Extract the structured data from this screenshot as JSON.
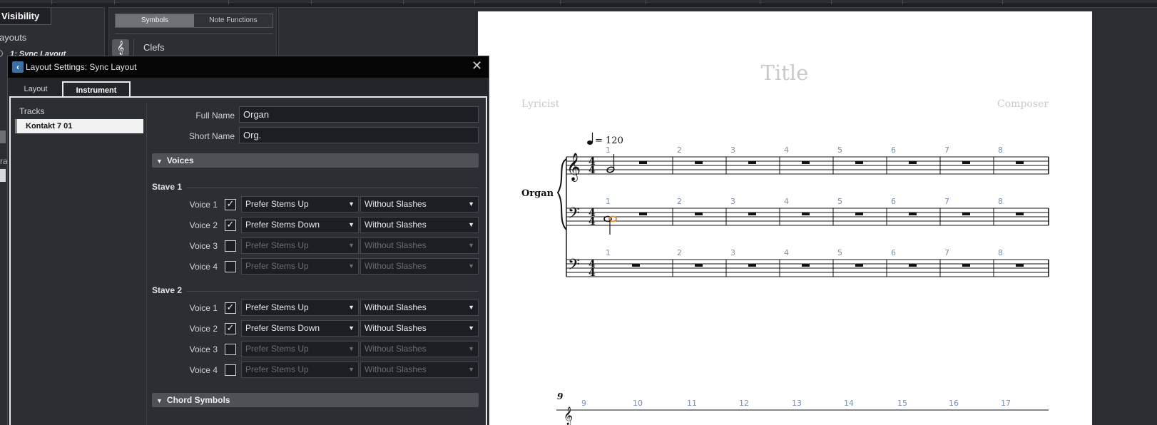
{
  "background": {
    "visibility_tab": "Visibility",
    "layouts_label": "ayouts",
    "sync_layout_item": "1: Sync Layout",
    "fragment_text": "ra",
    "symbols_tabs": [
      "Symbols",
      "Note Functions"
    ],
    "clefs_label": "Clefs"
  },
  "score": {
    "title": "Title",
    "lyricist": "Lyricist",
    "composer": "Composer",
    "tempo": "= 120",
    "instrument": "Organ",
    "bar_numbers": [
      "1",
      "2",
      "3",
      "4",
      "5",
      "6",
      "7",
      "8"
    ],
    "system2_bar_numbers": [
      "9",
      "10",
      "11",
      "12",
      "13",
      "14",
      "15",
      "16",
      "17"
    ],
    "system2_start": "9",
    "accent_color": "#e08a2a"
  },
  "dialog": {
    "title": "Layout Settings: Sync Layout",
    "tabs": {
      "layout": "Layout",
      "instrument": "Instrument"
    },
    "tracks_label": "Tracks",
    "selected_track": "Kontakt 7 01",
    "full_name_label": "Full Name",
    "full_name_value": "Organ",
    "short_name_label": "Short Name",
    "short_name_value": "Org.",
    "voices_section": "Voices",
    "chord_section": "Chord Symbols",
    "staves": [
      {
        "title": "Stave 1",
        "voices": [
          {
            "label": "Voice 1",
            "checked": true,
            "stem": "Prefer Stems Up",
            "slash": "Without Slashes"
          },
          {
            "label": "Voice 2",
            "checked": true,
            "stem": "Prefer Stems Down",
            "slash": "Without Slashes"
          },
          {
            "label": "Voice 3",
            "checked": false,
            "stem": "Prefer Stems Up",
            "slash": "Without Slashes"
          },
          {
            "label": "Voice 4",
            "checked": false,
            "stem": "Prefer Stems Up",
            "slash": "Without Slashes"
          }
        ]
      },
      {
        "title": "Stave 2",
        "voices": [
          {
            "label": "Voice 1",
            "checked": true,
            "stem": "Prefer Stems Up",
            "slash": "Without Slashes"
          },
          {
            "label": "Voice 2",
            "checked": true,
            "stem": "Prefer Stems Down",
            "slash": "Without Slashes"
          },
          {
            "label": "Voice 3",
            "checked": false,
            "stem": "Prefer Stems Up",
            "slash": "Without Slashes"
          },
          {
            "label": "Voice 4",
            "checked": false,
            "stem": "Prefer Stems Up",
            "slash": "Without Slashes"
          }
        ]
      }
    ]
  }
}
